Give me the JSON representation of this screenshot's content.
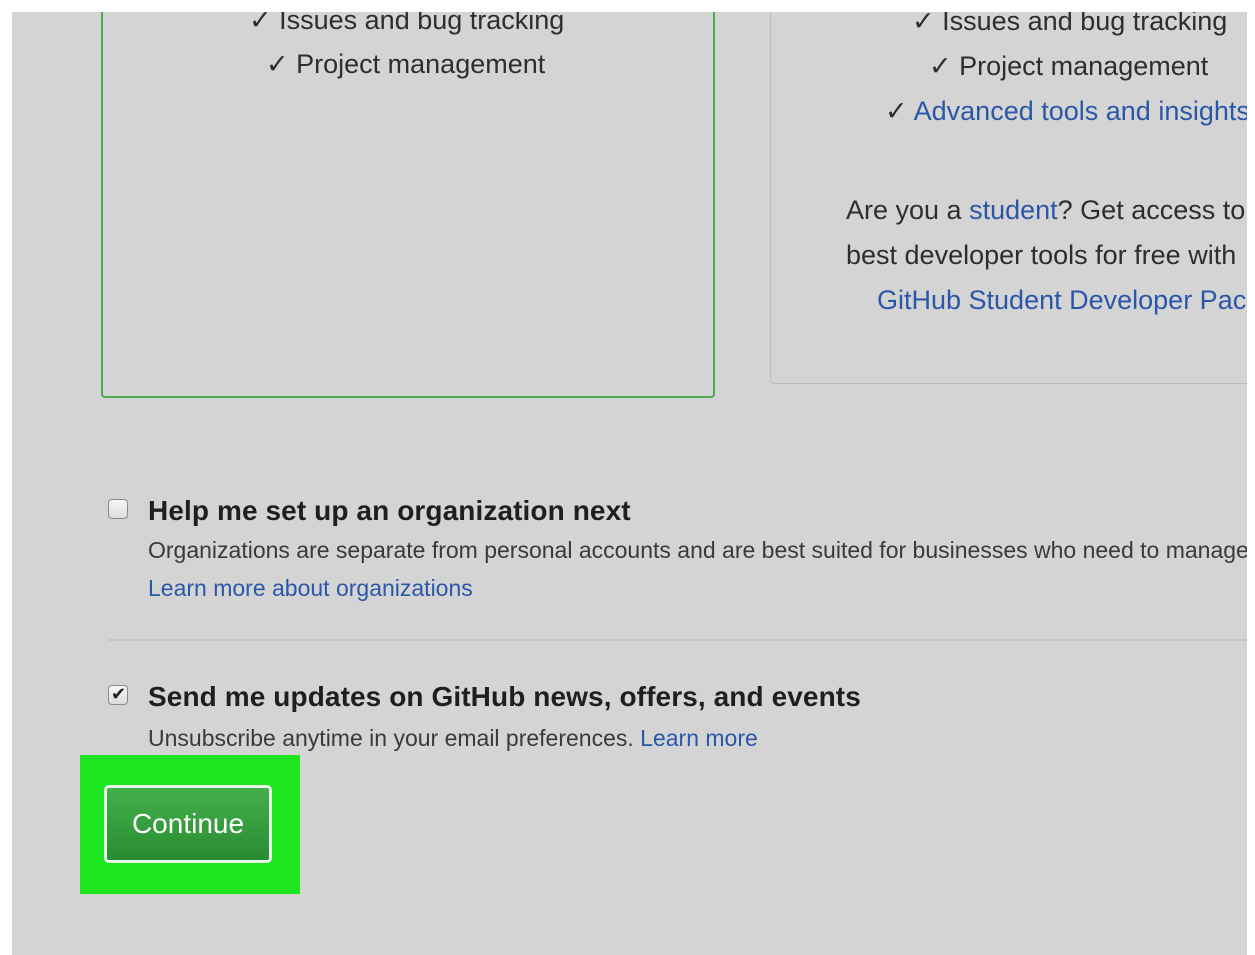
{
  "plans": {
    "free": {
      "features": [
        "✓ Issues and bug tracking",
        "✓ Project management"
      ]
    },
    "pro": {
      "features": [
        "✓ Issues and bug tracking",
        "✓ Project management"
      ],
      "advanced_check": "✓",
      "advanced_link": "Advanced tools and insights",
      "student_prefix": "Are you a ",
      "student_link": "student",
      "student_suffix": "? Get access to",
      "student_line2": "best developer tools for free with",
      "student_pack_link": "GitHub Student Developer Pack"
    }
  },
  "options": {
    "organization": {
      "checked": false,
      "title": "Help me set up an organization next",
      "description": "Organizations are separate from personal accounts and are best suited for businesses who need to manage",
      "link": "Learn more about organizations"
    },
    "updates": {
      "checked": true,
      "title": "Send me updates on GitHub news, offers, and events",
      "description": "Unsubscribe anytime in your email preferences. ",
      "link": "Learn more"
    }
  },
  "actions": {
    "continue_label": "Continue"
  },
  "colors": {
    "page_background": "#d4d4d4",
    "selected_border": "#4fab53",
    "link": "#2b57a8",
    "button": "#2f9a38",
    "highlight": "#1ce61f"
  }
}
